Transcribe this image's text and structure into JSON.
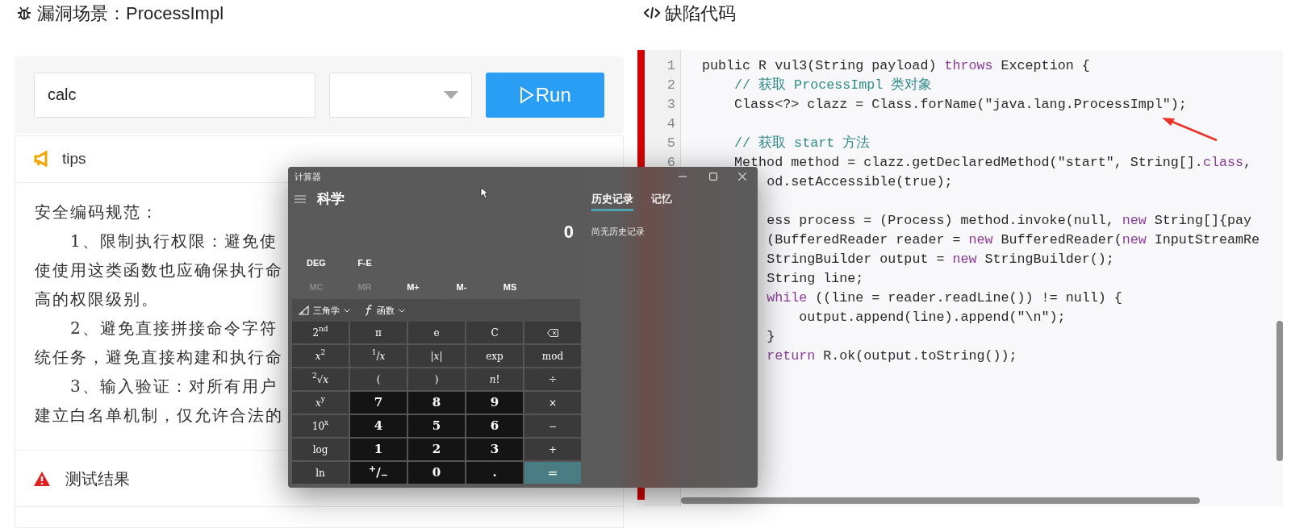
{
  "scenario": {
    "title": "漏洞场景：ProcessImpl",
    "command_input": {
      "value": "calc"
    },
    "run_button": {
      "label": "Run"
    },
    "tips": {
      "title": "tips",
      "lines": [
        {
          "kind": "plain",
          "text": "安全编码规范："
        },
        {
          "kind": "indented",
          "text": "1、限制执行权限：避免使"
        },
        {
          "kind": "plain",
          "text": "使使用这类函数也应确保执行命"
        },
        {
          "kind": "plain",
          "text": "高的权限级别。"
        },
        {
          "kind": "indented",
          "text": "2、避免直接拼接命令字符"
        },
        {
          "kind": "plain",
          "text": "统任务，避免直接构建和执行命"
        },
        {
          "kind": "indented",
          "text": "3、输入验证：对所有用户"
        },
        {
          "kind": "plain",
          "text": "建立白名单机制，仅允许合法的"
        }
      ]
    },
    "result": {
      "title": "测试结果"
    }
  },
  "code_panel": {
    "title": "缺陷代码",
    "lines": [
      {
        "kind": "code",
        "number": "1",
        "segments": [
          {
            "kind": "plain",
            "text": "public R vul3(String payload) "
          },
          {
            "kind": "keyword",
            "text": "throws"
          },
          {
            "kind": "plain",
            "text": " Exception {"
          }
        ]
      },
      {
        "kind": "code",
        "number": "2",
        "segments": [
          {
            "kind": "comment",
            "text": "    // 获取 ProcessImpl 类对象"
          }
        ]
      },
      {
        "kind": "code",
        "number": "3",
        "segments": [
          {
            "kind": "plain",
            "text": "    Class<?> clazz = Class.forName(\"java.lang.ProcessImpl\");"
          }
        ]
      },
      {
        "kind": "blank",
        "number": "4"
      },
      {
        "kind": "code",
        "number": "5",
        "segments": [
          {
            "kind": "comment",
            "text": "    // 获取 start 方法"
          }
        ]
      },
      {
        "kind": "code",
        "number": "6",
        "segments": [
          {
            "kind": "plain",
            "text": "    Method method = clazz.getDeclaredMethod(\"start\", String[]."
          },
          {
            "kind": "keyword",
            "text": "class"
          },
          {
            "kind": "plain",
            "text": ","
          }
        ]
      },
      {
        "kind": "code",
        "segments": [
          {
            "kind": "plain",
            "text": "        od.setAccessible(true);"
          }
        ]
      },
      {
        "kind": "blank"
      },
      {
        "kind": "code",
        "segments": [
          {
            "kind": "plain",
            "text": "        ess process = (Process) method.invoke(null, "
          },
          {
            "kind": "keyword",
            "text": "new"
          },
          {
            "kind": "plain",
            "text": " String[]{pay"
          }
        ]
      },
      {
        "kind": "code",
        "segments": [
          {
            "kind": "plain",
            "text": "        (BufferedReader reader = "
          },
          {
            "kind": "keyword",
            "text": "new"
          },
          {
            "kind": "plain",
            "text": " BufferedReader("
          },
          {
            "kind": "keyword",
            "text": "new"
          },
          {
            "kind": "plain",
            "text": " InputStreamRe"
          }
        ]
      },
      {
        "kind": "code",
        "segments": [
          {
            "kind": "plain",
            "text": "        StringBuilder output = "
          },
          {
            "kind": "keyword",
            "text": "new"
          },
          {
            "kind": "plain",
            "text": " StringBuilder();"
          }
        ]
      },
      {
        "kind": "code",
        "segments": [
          {
            "kind": "plain",
            "text": "        String line;"
          }
        ]
      },
      {
        "kind": "code",
        "segments": [
          {
            "kind": "keyword",
            "text": "        while"
          },
          {
            "kind": "plain",
            "text": " ((line = reader.readLine()) != null) {"
          }
        ]
      },
      {
        "kind": "code",
        "segments": [
          {
            "kind": "plain",
            "text": "            output.append(line).append(\"\\n\");"
          }
        ]
      },
      {
        "kind": "code",
        "segments": [
          {
            "kind": "plain",
            "text": "        }"
          }
        ]
      },
      {
        "kind": "code",
        "segments": [
          {
            "kind": "keyword",
            "text": "        return"
          },
          {
            "kind": "plain",
            "text": " R.ok(output.toString());"
          }
        ]
      }
    ]
  },
  "calculator": {
    "window_title": "计算器",
    "mode": "科学",
    "tabs": [
      {
        "label": "历史记录",
        "selected": true
      },
      {
        "label": "记忆",
        "selected": false
      }
    ],
    "display": "0",
    "history_empty": "尚无历史记录",
    "angle_buttons": [
      "DEG",
      "F-E"
    ],
    "memory_buttons": [
      {
        "label": "MC",
        "disabled": true
      },
      {
        "label": "MR",
        "disabled": true
      },
      {
        "label": "M+",
        "disabled": false
      },
      {
        "label": "M-",
        "disabled": false
      },
      {
        "label": "MS",
        "disabled": false
      }
    ],
    "menus": [
      {
        "kind": "trig",
        "label": "三角学"
      },
      {
        "kind": "function",
        "label": "函数"
      }
    ],
    "keys": [
      {
        "kind": "function",
        "label": "2$^{nd}$"
      },
      {
        "kind": "function",
        "label": "π"
      },
      {
        "kind": "function",
        "label": "e"
      },
      {
        "kind": "function",
        "label": "C"
      },
      {
        "kind": "backspace"
      },
      {
        "kind": "function",
        "label": "*x*$^{2}$"
      },
      {
        "kind": "function",
        "label": "$^{1}$/*x*"
      },
      {
        "kind": "function",
        "label": "|*x*|"
      },
      {
        "kind": "function",
        "label": "exp"
      },
      {
        "kind": "function",
        "label": "mod"
      },
      {
        "kind": "function",
        "label": "$^{2}$√*x*"
      },
      {
        "kind": "function",
        "label": "("
      },
      {
        "kind": "function",
        "label": ")"
      },
      {
        "kind": "function",
        "label": "*n*!"
      },
      {
        "kind": "function",
        "label": "÷"
      },
      {
        "kind": "function",
        "label": "*x*$^{y}$"
      },
      {
        "kind": "digit",
        "label": "7"
      },
      {
        "kind": "digit",
        "label": "8"
      },
      {
        "kind": "digit",
        "label": "9"
      },
      {
        "kind": "function",
        "label": "×"
      },
      {
        "kind": "function",
        "label": "10$^{x}$"
      },
      {
        "kind": "digit",
        "label": "4"
      },
      {
        "kind": "digit",
        "label": "5"
      },
      {
        "kind": "digit",
        "label": "6"
      },
      {
        "kind": "function",
        "label": "−"
      },
      {
        "kind": "function",
        "label": "log"
      },
      {
        "kind": "digit",
        "label": "1"
      },
      {
        "kind": "digit",
        "label": "2"
      },
      {
        "kind": "digit",
        "label": "3"
      },
      {
        "kind": "function",
        "label": "+"
      },
      {
        "kind": "function",
        "label": "ln"
      },
      {
        "kind": "digit",
        "label": "$^{+}$/$_{−}$"
      },
      {
        "kind": "digit",
        "label": "0"
      },
      {
        "kind": "digit",
        "label": "."
      },
      {
        "kind": "equals",
        "label": "="
      }
    ]
  }
}
